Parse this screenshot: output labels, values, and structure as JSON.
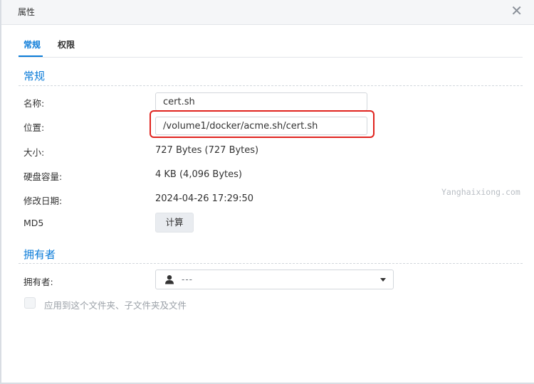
{
  "window": {
    "title": "属性",
    "close_glyph": "✕"
  },
  "tabs": [
    {
      "label": "常规",
      "active": true
    },
    {
      "label": "权限",
      "active": false
    }
  ],
  "general": {
    "section_title": "常规",
    "name_label": "名称:",
    "name_value": "cert.sh",
    "location_label": "位置:",
    "location_value": "/volume1/docker/acme.sh/cert.sh",
    "size_label": "大小:",
    "size_value": "727 Bytes (727 Bytes)",
    "disk_label": "硬盘容量:",
    "disk_value": "4 KB (4,096 Bytes)",
    "modified_label": "修改日期:",
    "modified_value": "2024-04-26 17:29:50",
    "md5_label": "MD5",
    "md5_button": "计算"
  },
  "owner": {
    "section_title": "拥有者",
    "owner_label": "拥有者:",
    "owner_value": "---",
    "apply_label": "应用到这个文件夹、子文件夹及文件"
  },
  "watermark": "Yanghaixiong.com",
  "colors": {
    "accent": "#0a7bd8",
    "highlight": "#e0231e"
  }
}
